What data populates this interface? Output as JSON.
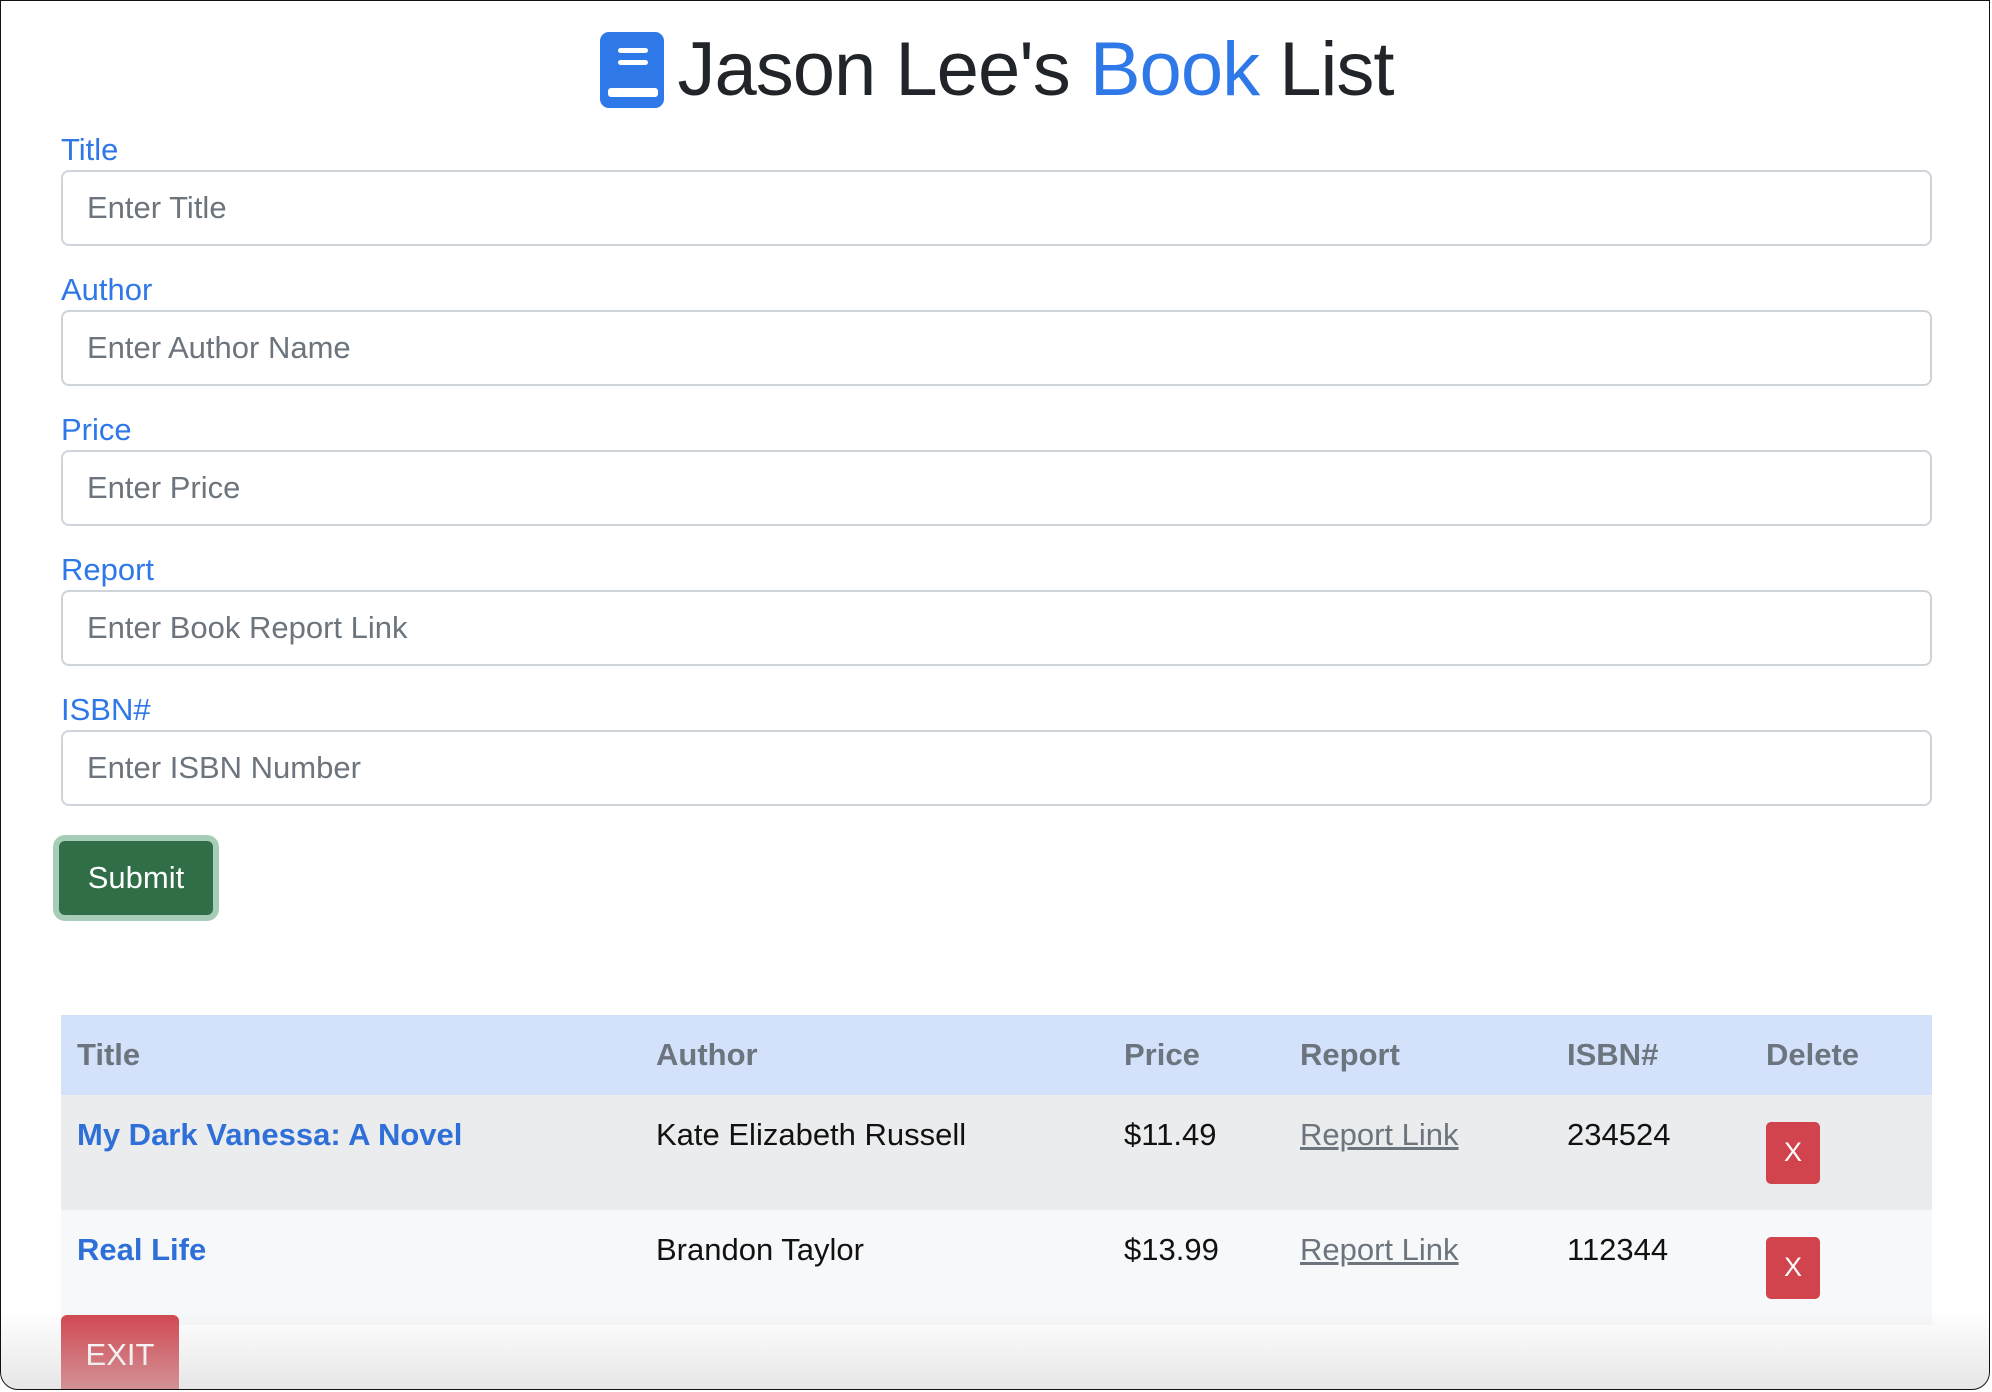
{
  "header": {
    "title_prefix": "Jason Lee's",
    "title_accent": "Book",
    "title_suffix": "List",
    "icon": "book-icon",
    "accent_color": "#2f78e8"
  },
  "form": {
    "fields": [
      {
        "label": "Title",
        "placeholder": "Enter Title",
        "value": ""
      },
      {
        "label": "Author",
        "placeholder": "Enter Author Name",
        "value": ""
      },
      {
        "label": "Price",
        "placeholder": "Enter Price",
        "value": ""
      },
      {
        "label": "Report",
        "placeholder": "Enter Book Report Link",
        "value": ""
      },
      {
        "label": "ISBN#",
        "placeholder": "Enter ISBN Number",
        "value": ""
      }
    ],
    "submit_label": "Submit",
    "submit_color": "#2f6e47"
  },
  "table": {
    "headers": [
      "Title",
      "Author",
      "Price",
      "Report",
      "ISBN#",
      "Delete"
    ],
    "rows": [
      {
        "title": "My Dark Vanessa: A Novel",
        "author": "Kate Elizabeth Russell",
        "price": "$11.49",
        "report": "Report Link",
        "isbn": "234524",
        "delete": "X"
      },
      {
        "title": "Real Life",
        "author": "Brandon Taylor",
        "price": "$13.99",
        "report": "Report Link",
        "isbn": "112344",
        "delete": "X"
      }
    ],
    "header_bg": "#d3e1fb",
    "delete_color": "#d1434d"
  },
  "exit_label": "EXIT"
}
